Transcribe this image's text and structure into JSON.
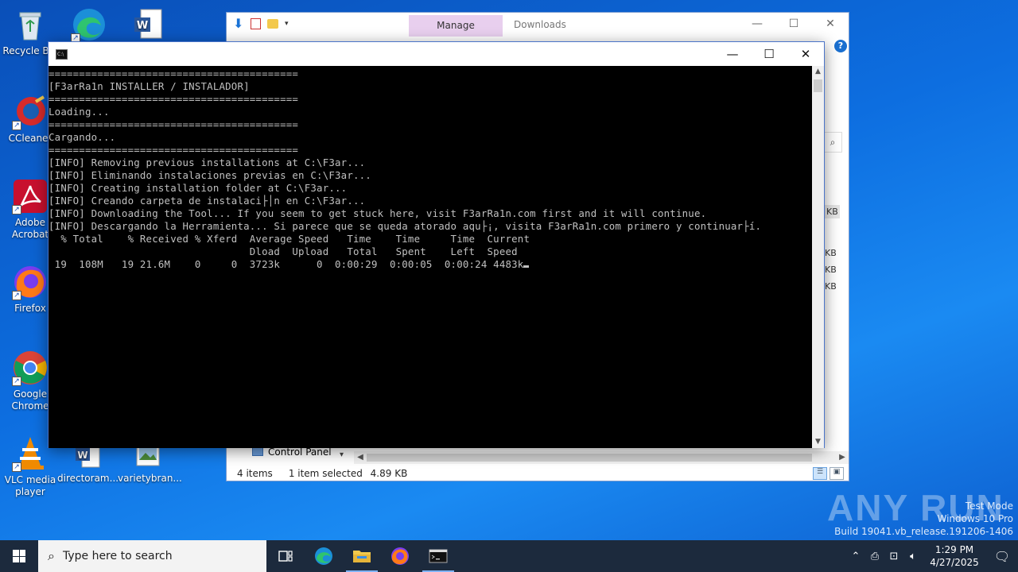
{
  "desktop": {
    "icons": [
      {
        "label": "Recycle Bin",
        "icon": "recycle-bin-icon"
      },
      {
        "label": "CCleaner",
        "icon": "ccleaner-icon"
      },
      {
        "label": "Adobe Acrobat",
        "icon": "adobe-acrobat-icon"
      },
      {
        "label": "Firefox",
        "icon": "firefox-icon"
      },
      {
        "label": "Google Chrome",
        "icon": "chrome-icon"
      },
      {
        "label": "VLC media player",
        "icon": "vlc-icon"
      },
      {
        "label": "directoram...",
        "icon": "word-document-icon"
      },
      {
        "label": "varietybran...",
        "icon": "image-file-icon"
      }
    ]
  },
  "explorer": {
    "ribbon_tab": "Manage",
    "title": "Downloads",
    "controls": {
      "minimize": "—",
      "maximize": "☐",
      "close": "✕"
    },
    "help": "?",
    "sizes": [
      "KB",
      "KB",
      "KB",
      "KB"
    ],
    "nav_item": "Control Panel",
    "status": {
      "items": "4 items",
      "selected": "1 item selected",
      "size": "4.89 KB"
    }
  },
  "console": {
    "controls": {
      "minimize": "—",
      "maximize": "☐",
      "close": "✕"
    },
    "lines": [
      "=========================================",
      "[F3arRa1n INSTALLER / INSTALADOR]",
      "=========================================",
      "Loading...",
      "=========================================",
      "Cargando...",
      "=========================================",
      "[INFO] Removing previous installations at C:\\F3ar...",
      "[INFO] Eliminando instalaciones previas en C:\\F3ar...",
      "[INFO] Creating installation folder at C:\\F3ar...",
      "[INFO] Creando carpeta de instalaci├│n en C:\\F3ar...",
      "[INFO] Downloading the Tool... If you seem to get stuck here, visit F3arRa1n.com first and it will continue.",
      "[INFO] Descargando la Herramienta... Si parece que se queda atorado aqu├¡, visita F3arRa1n.com primero y continuar├í.",
      "  % Total    % Received % Xferd  Average Speed   Time    Time     Time  Current",
      "                                 Dload  Upload   Total   Spent    Left  Speed",
      " 19  108M   19 21.6M    0     0  3723k      0  0:00:29  0:00:05  0:00:24 4483k"
    ]
  },
  "watermark": {
    "brand": "ANY RUN",
    "line1": "Test Mode",
    "line2": "Windows 10 Pro",
    "line3": "Build 19041.vb_release.191206-1406"
  },
  "taskbar": {
    "search_placeholder": "Type here to search",
    "apps": [
      "task-view-icon",
      "edge-icon",
      "file-explorer-icon",
      "firefox-icon",
      "cmd-icon"
    ],
    "time": "1:29 PM",
    "date": "4/27/2025"
  }
}
